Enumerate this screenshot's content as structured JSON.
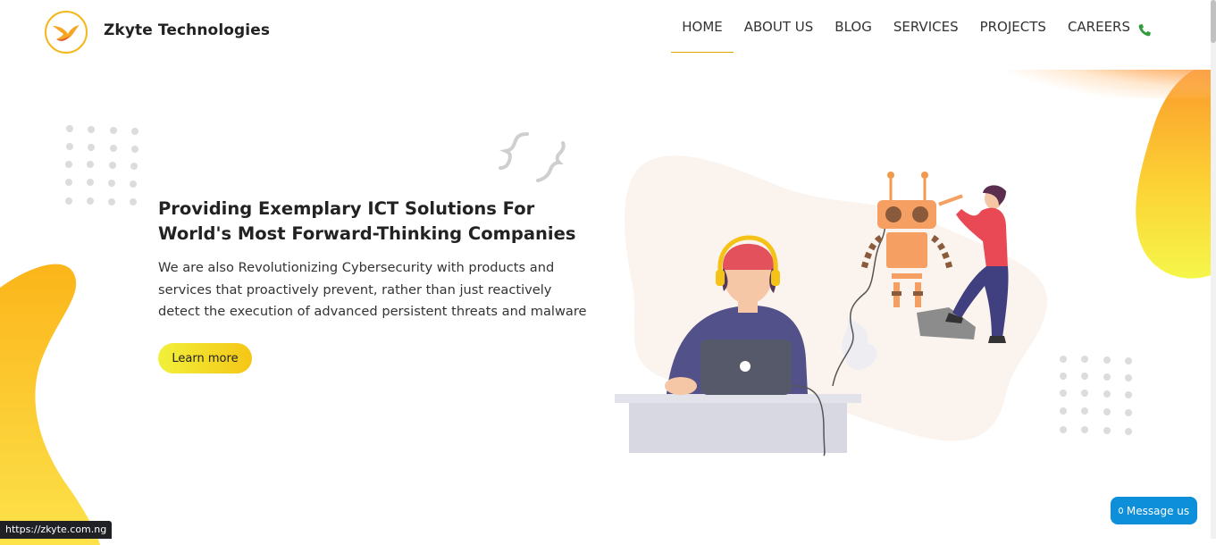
{
  "brand": {
    "name": "Zkyte Technologies"
  },
  "nav": {
    "items": [
      {
        "label": "HOME",
        "active": true
      },
      {
        "label": "ABOUT US"
      },
      {
        "label": "BLOG"
      },
      {
        "label": "SERVICES"
      },
      {
        "label": "PROJECTS"
      },
      {
        "label": "CAREERS"
      }
    ],
    "phone_icon": "phone-icon"
  },
  "hero": {
    "title": "Providing Exemplary ICT Solutions For World's Most Forward-Thinking Companies",
    "text": "We are also Revolutionizing Cybersecurity with products and services that proactively prevent, rather than just reactively detect the execution of advanced persistent threats and malware",
    "cta_label": "Learn more"
  },
  "status_bar": {
    "url": "https://zkyte.com.ng"
  },
  "chat": {
    "label": "Message us"
  },
  "colors": {
    "accent": "#f5b71c",
    "orange": "#fb8c2d",
    "yellow": "#f1f03a",
    "chat_blue": "#0e8fd9",
    "phone_green": "#2e9c3c"
  }
}
